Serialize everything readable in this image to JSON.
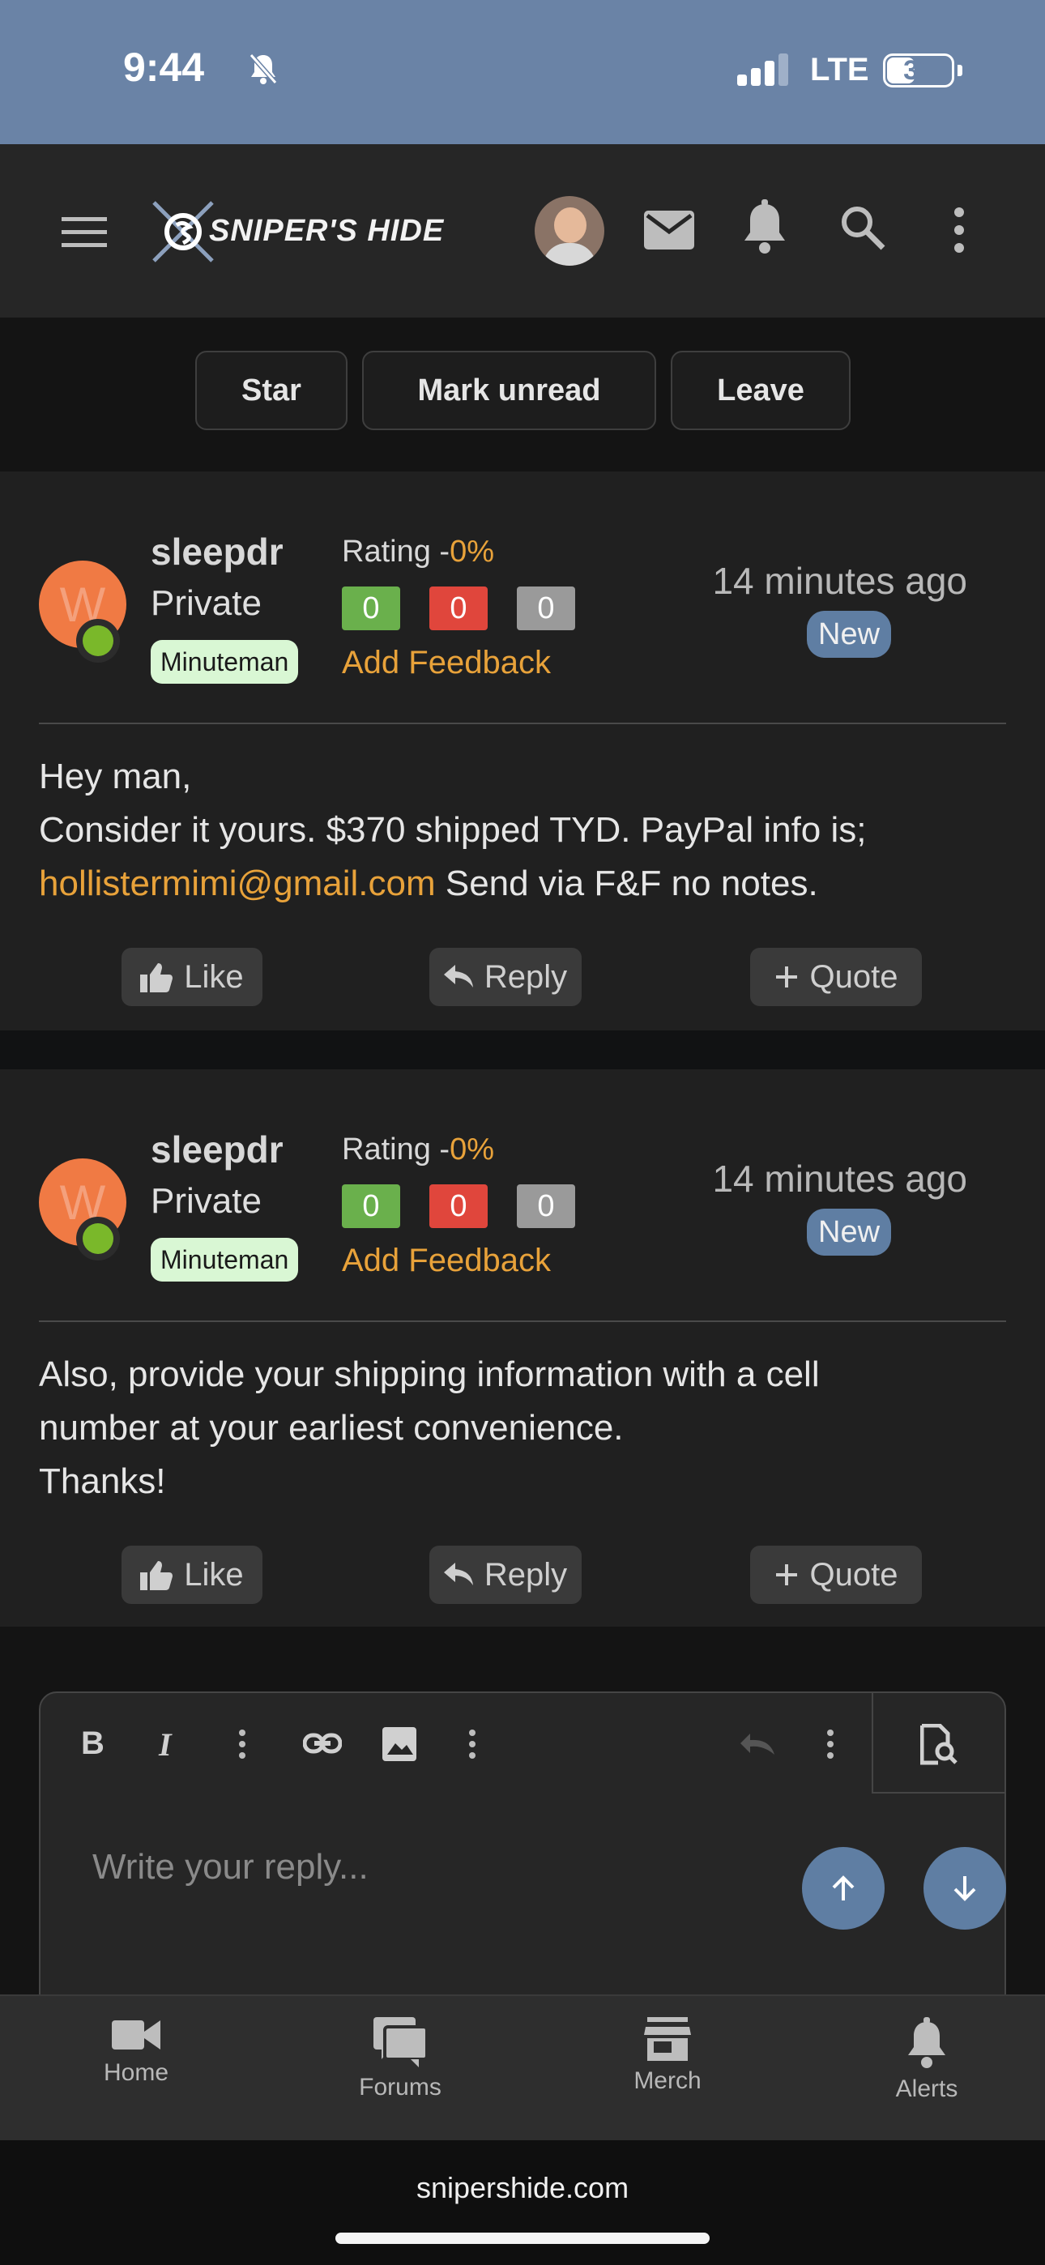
{
  "status": {
    "time": "9:44",
    "network": "LTE",
    "battery": "35"
  },
  "header": {
    "site_name": "SNIPER'S HIDE"
  },
  "actions": {
    "star": "Star",
    "mark_unread": "Mark unread",
    "leave": "Leave"
  },
  "posts": [
    {
      "avatar_letter": "W",
      "username": "sleepdr",
      "user_title": "Private",
      "badge": "Minuteman",
      "rating_label": "Rating -",
      "rating_pct": "0%",
      "positive": "0",
      "negative": "0",
      "neutral": "0",
      "add_feedback": "Add Feedback",
      "time": "14 minutes ago",
      "new_label": "New",
      "line1": "Hey man,",
      "line2": "Consider it yours. $370 shipped TYD. PayPal info is;",
      "email": "hollistermimi@gmail.com",
      "line3_rest": " Send via F&F no notes.",
      "like": "Like",
      "reply": "Reply",
      "quote": "Quote"
    },
    {
      "avatar_letter": "W",
      "username": "sleepdr",
      "user_title": "Private",
      "badge": "Minuteman",
      "rating_label": "Rating -",
      "rating_pct": "0%",
      "positive": "0",
      "negative": "0",
      "neutral": "0",
      "add_feedback": "Add Feedback",
      "time": "14 minutes ago",
      "new_label": "New",
      "line1": "Also, provide your shipping information with a cell",
      "line2": "number at your earliest convenience.",
      "line3": "Thanks!",
      "like": "Like",
      "reply": "Reply",
      "quote": "Quote"
    }
  ],
  "editor": {
    "placeholder": "Write your reply..."
  },
  "nav": {
    "home": "Home",
    "forums": "Forums",
    "merch": "Merch",
    "alerts": "Alerts"
  },
  "browser": {
    "domain": "snipershide.com"
  },
  "colors": {
    "accent": "#e8a23a",
    "status_blue": "#6a83a6",
    "new_tag": "#5f7ea3",
    "positive": "#6ab04c",
    "negative": "#e0463c",
    "neutral": "#9a9a9a"
  }
}
